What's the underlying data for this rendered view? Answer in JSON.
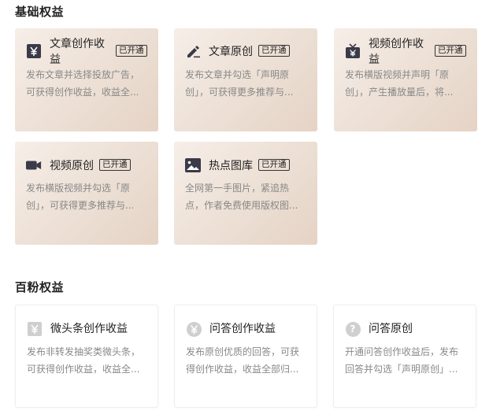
{
  "sections": {
    "basic": {
      "title": "基础权益"
    },
    "fans100": {
      "title": "百粉权益"
    }
  },
  "cards": {
    "article_income": {
      "title": "文章创作收益",
      "badge": "已开通",
      "desc": "发布文章并选择投放广告，可获得创作收益，收益全...",
      "icon": "yuan-square-icon"
    },
    "article_original": {
      "title": "文章原创",
      "badge": "已开通",
      "desc": "发布文章并勾选「声明原创」，可获得更多推荐与...",
      "icon": "pen-icon"
    },
    "video_income": {
      "title": "视频创作收益",
      "badge": "已开通",
      "desc": "发布横版视频并声明「原创」，产生播放量后，将...",
      "icon": "tv-icon"
    },
    "video_original": {
      "title": "视频原创",
      "badge": "已开通",
      "desc": "发布横版视频并勾选「原创」，可获得更多推荐与...",
      "icon": "video-camera-icon"
    },
    "hot_images": {
      "title": "热点图库",
      "badge": "已开通",
      "desc": "全网第一手图片，紧追热点，作者免费使用版权图...",
      "icon": "image-icon"
    },
    "weitoutiao_income": {
      "title": "微头条创作收益",
      "desc": "发布非转发抽奖类微头条，可获得创作收益，收益全...",
      "icon": "yuan-square-icon"
    },
    "qa_income": {
      "title": "问答创作收益",
      "desc": "发布原创优质的回答，可获得创作收益，收益全部归...",
      "icon": "yuan-circle-icon"
    },
    "qa_original": {
      "title": "问答原创",
      "desc": "开通问答创作收益后，发布回答并勾选「声明原创」...",
      "icon": "question-circle-icon"
    }
  },
  "colors": {
    "card_gold_start": "#f6eee8",
    "card_gold_end": "#e5d3c5",
    "icon_dark": "#3a3a48",
    "icon_grey": "#cfcfcf",
    "desc_text": "#888888"
  }
}
